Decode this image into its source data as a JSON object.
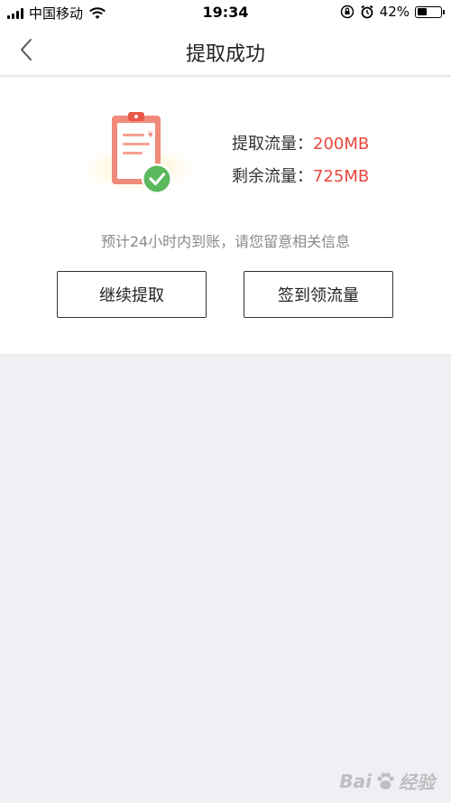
{
  "status_bar": {
    "carrier": "中国移动",
    "time": "19:34",
    "battery_percent": "42%",
    "battery_level": 0.42,
    "icons": [
      "signal-icon",
      "wifi-icon",
      "rotation-lock-icon",
      "alarm-icon",
      "battery-icon"
    ]
  },
  "nav": {
    "title": "提取成功",
    "back_icon": "chevron-left-icon"
  },
  "result": {
    "extracted_label": "提取流量：",
    "extracted_value": "200MB",
    "remaining_label": "剩余流量：",
    "remaining_value": "725MB",
    "notice": "预计24小时内到账，请您留意相关信息"
  },
  "actions": {
    "continue_label": "继续提取",
    "checkin_label": "签到领流量"
  },
  "watermark": {
    "text": "Bai",
    "text2": "经验"
  },
  "colors": {
    "accent_red": "#e8473c",
    "success_green": "#5bb85d",
    "background": "#efeff4"
  }
}
